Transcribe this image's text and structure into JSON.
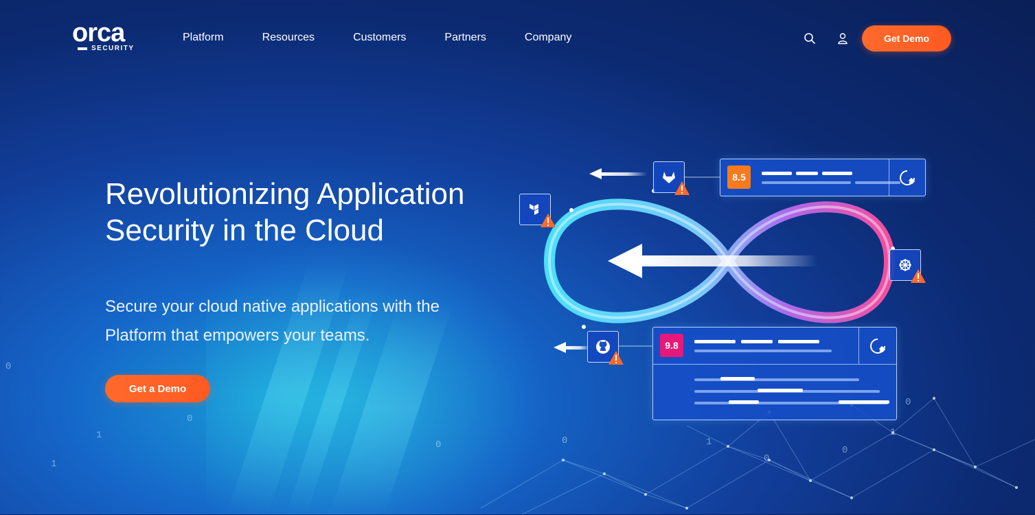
{
  "brand": {
    "name": "orca",
    "sub": "SECURITY"
  },
  "nav": {
    "items": [
      {
        "label": "Platform"
      },
      {
        "label": "Resources"
      },
      {
        "label": "Customers"
      },
      {
        "label": "Partners"
      },
      {
        "label": "Company"
      }
    ],
    "search_icon": "search-icon",
    "user_icon": "user-icon",
    "cta": "Get Demo"
  },
  "hero": {
    "title": "Revolutionizing Application Security in the Cloud",
    "subtitle": "Secure your cloud native applications with the Platform that empowers your teams.",
    "cta": "Get a Demo"
  },
  "graphic": {
    "cards": [
      {
        "score": "8.5",
        "score_color": "#f77a1e"
      },
      {
        "score": "9.8",
        "score_color": "#e6197a"
      }
    ],
    "tools": [
      "gitlab-icon",
      "terraform-icon",
      "kubernetes-icon",
      "github-icon"
    ]
  },
  "colors": {
    "accent": "#ff6326",
    "bg_dark": "#0a1f57",
    "bg_mid": "#1565c8"
  }
}
